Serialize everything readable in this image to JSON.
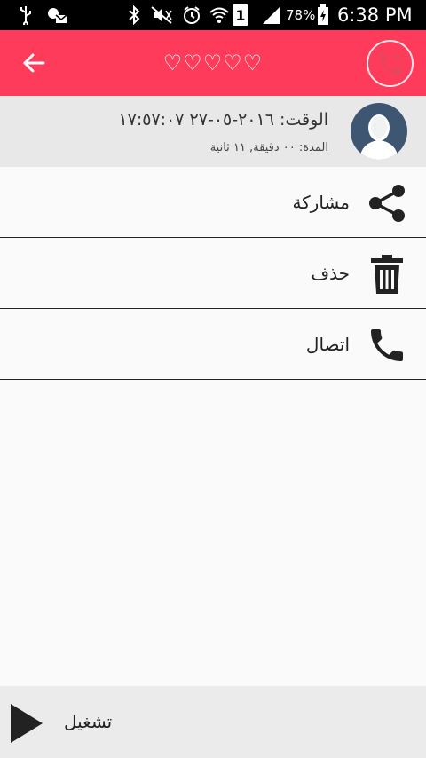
{
  "status_bar": {
    "battery": "78%",
    "sim_slot": "1",
    "time": "6:38 PM"
  },
  "app_bar": {
    "title": "♡♡♡♡♡"
  },
  "call_info": {
    "time": "الوقت: ٢٠١٦-٠٥-٢٧ ١٧:٥٧:٠٧",
    "duration": "المدة: ٠٠ دقيقة, ١١ ثانية"
  },
  "actions": [
    {
      "label": "مشاركة",
      "icon": "share-icon"
    },
    {
      "label": "حذف",
      "icon": "trash-icon"
    },
    {
      "label": "اتصال",
      "icon": "phone-icon"
    }
  ],
  "player": {
    "label": "تشغيل",
    "icon": "play-icon"
  },
  "colors": {
    "accent": "#ff3b5c",
    "avatar": "#3f5673",
    "header_bg": "#e8e8e8"
  }
}
